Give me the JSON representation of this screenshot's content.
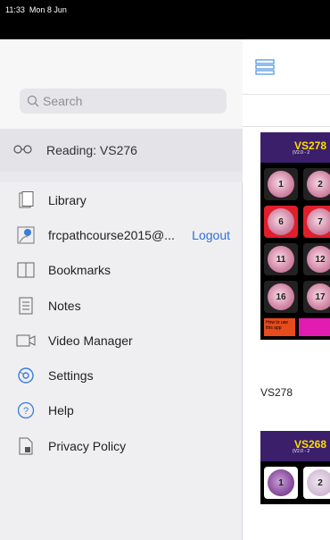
{
  "status_bar": {
    "time": "11:33",
    "date": "Mon 8 Jun"
  },
  "sidebar": {
    "search": {
      "placeholder": "Search"
    },
    "reading": {
      "label": "Reading: VS276",
      "icon": "glasses-icon"
    },
    "menu": [
      {
        "id": "library",
        "label": "Library",
        "icon": "library-icon"
      },
      {
        "id": "account",
        "label": "frcpathcourse2015@...",
        "icon": "user-icon",
        "action": "Logout"
      },
      {
        "id": "bookmarks",
        "label": "Bookmarks",
        "icon": "bookmark-icon"
      },
      {
        "id": "notes",
        "label": "Notes",
        "icon": "notes-icon"
      },
      {
        "id": "video",
        "label": "Video Manager",
        "icon": "video-icon"
      },
      {
        "id": "settings",
        "label": "Settings",
        "icon": "gear-icon"
      },
      {
        "id": "help",
        "label": "Help",
        "icon": "help-icon"
      },
      {
        "id": "privacy",
        "label": "Privacy Policy",
        "icon": "privacy-doc-icon"
      }
    ]
  },
  "main": {
    "cards": [
      {
        "title": "VS278",
        "sub": "(V2.0 - 2",
        "caption": "VS278",
        "cells": [
          "1",
          "2",
          "",
          "6",
          "7",
          "",
          "11",
          "12",
          "",
          "16",
          "17",
          ""
        ],
        "footer_left": "How to use this app",
        "footer_right": ""
      },
      {
        "title": "VS268",
        "sub": "(V2.0 - 2",
        "caption": "",
        "cells": [
          "1",
          "2",
          ""
        ],
        "footer_left": "",
        "footer_right": ""
      }
    ]
  },
  "colors": {
    "accent": "#2f6fd6",
    "card_header": "#3b1f6b",
    "card_title": "#ffdd00"
  }
}
